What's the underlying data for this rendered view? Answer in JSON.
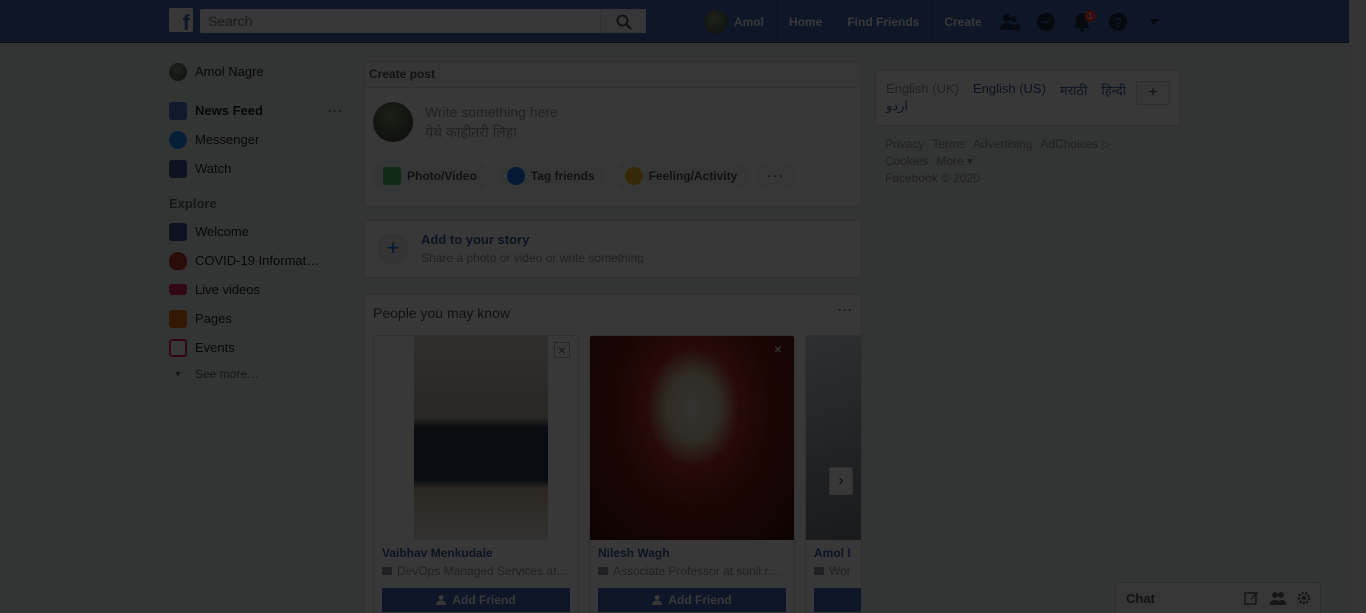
{
  "topbar": {
    "search_placeholder": "Search",
    "user_name": "Amol",
    "home": "Home",
    "find_friends": "Find Friends",
    "create": "Create",
    "notification_count": "1"
  },
  "sidebar": {
    "profile_name": "Amol Nagre",
    "items": [
      {
        "label": "News Feed",
        "icon": "news-feed-icon",
        "color": "#4a76c8"
      },
      {
        "label": "Messenger",
        "icon": "messenger-icon",
        "color": "#1c8ef9"
      },
      {
        "label": "Watch",
        "icon": "watch-icon",
        "color": "#3b5998"
      }
    ],
    "explore_heading": "Explore",
    "explore": [
      {
        "label": "Welcome",
        "icon": "facebook-icon",
        "color": "#3b5998"
      },
      {
        "label": "COVID-19 Informati…",
        "icon": "covid-shield-icon",
        "color": "#c0392b"
      },
      {
        "label": "Live videos",
        "icon": "live-icon",
        "color": "#e0245e"
      },
      {
        "label": "Pages",
        "icon": "flag-icon",
        "color": "#e9710f"
      },
      {
        "label": "Events",
        "icon": "calendar-icon",
        "color": "#e0245e"
      }
    ],
    "see_more": "See more…"
  },
  "composer": {
    "header": "Create post",
    "placeholder_en": "Write something here",
    "placeholder_mr": "येथे काहीतरी लिहा",
    "actions": [
      "Photo/Video",
      "Tag friends",
      "Feeling/Activity"
    ]
  },
  "story": {
    "title": "Add to your story",
    "subtitle": "Share a photo or video or write something"
  },
  "pymk": {
    "title": "People you may know",
    "people": [
      {
        "name": "Vaibhav Menkudale",
        "work": "DevOps Managed Services at…",
        "button": "Add Friend"
      },
      {
        "name": "Nilesh Wagh",
        "work": "Associate Professor at sunil r…",
        "button": "Add Friend"
      },
      {
        "name": "Amol I",
        "work": "Wor",
        "button": ""
      }
    ]
  },
  "languages": {
    "current": "English (UK)",
    "options": [
      "English (US)",
      "मराठी",
      "हिन्दी"
    ],
    "urdu": "اردو"
  },
  "footer": {
    "row1": [
      "Privacy",
      "Terms",
      "Advertising",
      "AdChoices ▷"
    ],
    "row2": [
      "Cookies",
      "More ▾"
    ],
    "copyright": "Facebook © 2020"
  },
  "chat": {
    "label": "Chat"
  }
}
